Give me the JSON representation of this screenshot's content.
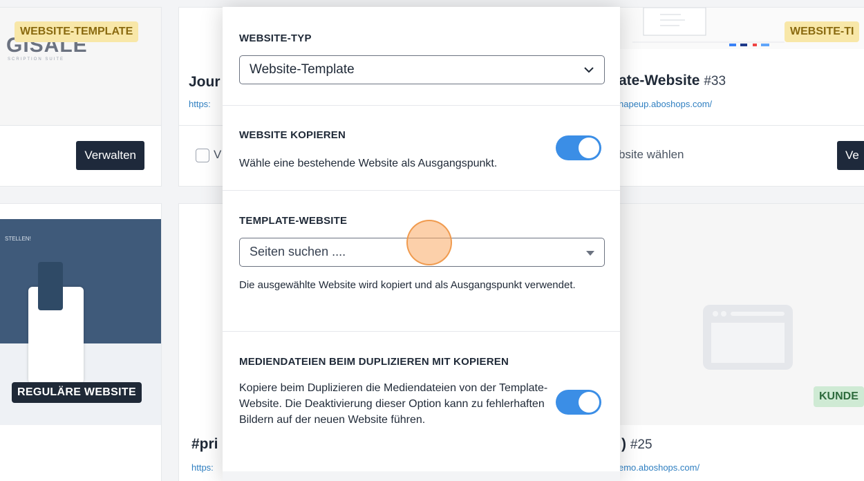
{
  "background": {
    "card_left_top": {
      "badge": "WEBSITE-TEMPLATE",
      "logo": "GISALE",
      "logo_sub": "SCRIPTION SUITE",
      "manage_button": "Verwalten"
    },
    "card_mid_top": {
      "title_fragment": "Jour",
      "url_fragment": "https:",
      "checkbox_label_fragment": "V"
    },
    "card_right_top": {
      "badge": "WEBSITE-TI",
      "title": "ate-Website",
      "number": "#33",
      "url": "hapeup.aboshops.com/",
      "choose_text": "bsite wählen",
      "button_fragment": "Ve"
    },
    "card_left_bottom": {
      "banner_text": "STELLEN!",
      "badge": "REGULÄRE WEBSITE"
    },
    "card_mid_bottom": {
      "title_fragment": "#pri",
      "url_fragment": "https:"
    },
    "card_right_bottom": {
      "badge": "KUNDE",
      "title_fragment": ")",
      "number": "#25",
      "url": "emo.aboshops.com/"
    }
  },
  "modal": {
    "website_type": {
      "label": "WEBSITE-TYP",
      "selected": "Website-Template"
    },
    "copy_website": {
      "label": "WEBSITE KOPIEREN",
      "description": "Wähle eine bestehende Website als Ausgangspunkt.",
      "enabled": true
    },
    "template_website": {
      "label": "TEMPLATE-WEBSITE",
      "placeholder": "Seiten suchen ....",
      "help": "Die ausgewählte Website wird kopiert und als Ausgangspunkt verwendet."
    },
    "copy_media": {
      "label": "MEDIENDATEIEN BEIM DUPLIZIEREN MIT KOPIEREN",
      "description": "Kopiere beim Duplizieren die Mediendateien von der Template-Website. Die Deaktivierung dieser Option kann zu fehlerhaften Bildern auf der neuen Website führen.",
      "enabled": true
    }
  },
  "colors": {
    "toggle_on": "#3b8ee6",
    "badge_dark": "#1f2937",
    "link": "#2f7fc1",
    "cursor": "#f5a05a"
  }
}
